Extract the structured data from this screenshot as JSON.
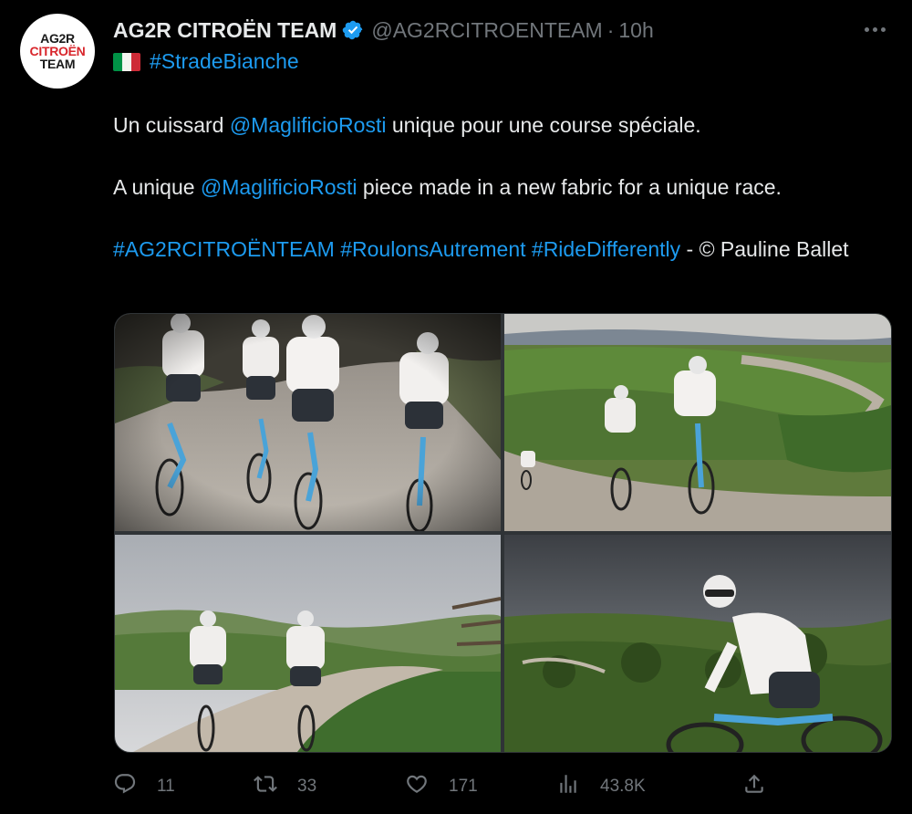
{
  "author": {
    "avatar_lines": [
      "AG2R",
      "CITROËN",
      "TEAM"
    ],
    "display_name": "AG2R CITROËN TEAM",
    "verified_icon": "verified-badge-icon",
    "handle": "@AG2RCITROENTEAM",
    "separator": "·",
    "time": "10h"
  },
  "more_icon": "more-horizontal-icon",
  "tagline": {
    "flag_icon": "italy-flag-icon",
    "hashtag": "#StradeBianche"
  },
  "tweet": {
    "p1_before": "Un cuissard ",
    "p1_mention": "@MaglificioRosti",
    "p1_after": " unique pour une course spéciale.",
    "p2_before": "A unique ",
    "p2_mention": "@MaglificioRosti",
    "p2_after": " piece made in a new fabric for a unique race.",
    "p3_tag1": "#AG2RCITROËNTEAM",
    "p3_tag2": "#RoulonsAutrement",
    "p3_tag3": "#RideDifferently",
    "p3_after": " - © Pauline Ballet"
  },
  "media": {
    "count": 4
  },
  "actions": {
    "reply": {
      "icon": "reply-icon",
      "count": "11"
    },
    "retweet": {
      "icon": "retweet-icon",
      "count": "33"
    },
    "like": {
      "icon": "heart-icon",
      "count": "171"
    },
    "views": {
      "icon": "views-icon",
      "count": "43.8K"
    },
    "share": {
      "icon": "share-icon"
    }
  },
  "colors": {
    "background": "#000000",
    "text": "#e7e9ea",
    "muted": "#71767b",
    "link": "#1d9bf0",
    "brand_red": "#d8262c"
  }
}
